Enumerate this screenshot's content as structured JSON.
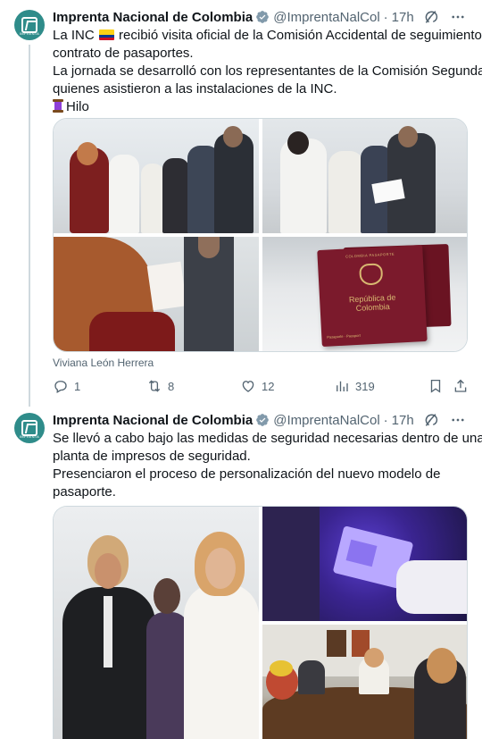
{
  "tweets": [
    {
      "author": "Imprenta Nacional de Colombia",
      "handle": "@ImprentaNalCol",
      "dot": "·",
      "time": "17h",
      "avatar_caption": "IMPRENTA",
      "text_lines": [
        {
          "before_flag": "La INC ",
          "after_flag": " recibió visita oficial de la Comisión Accidental de seguimiento al"
        },
        "contrato de pasaportes.",
        "La jornada se desarrolló con los representantes de la Comisión Segunda,",
        "quienes asistieron a las instalaciones de la INC."
      ],
      "thread_label": "Hilo",
      "media_credit": "Viviana León Herrera",
      "media_alts": [
        "Visitors touring the passport production facility",
        "Officials examining passports",
        "Woman inspecting a passport document",
        "Passport of República de Colombia"
      ],
      "passport": {
        "title": "República de Colombia",
        "header": "COLOMBIA  PASAPORTE",
        "footer": "Pasaporte · Passport"
      },
      "counts": {
        "replies": "1",
        "reposts": "8",
        "likes": "12",
        "views": "319"
      }
    },
    {
      "author": "Imprenta Nacional de Colombia",
      "handle": "@ImprentaNalCol",
      "dot": "·",
      "time": "17h",
      "avatar_caption": "IMPRENTA",
      "text_lines": [
        "Se llevó a cabo bajo las medidas de seguridad necesarias dentro de una",
        "planta de impresos de seguridad.",
        "Presenciaron el proceso de personalización del nuevo modelo de",
        "pasaporte."
      ],
      "media_alts": [
        "Officials walking through the printing plant",
        "Passport page under ultraviolet light",
        "Meeting around a conference table"
      ]
    }
  ],
  "colors": {
    "accent": "#1d9bf0",
    "muted": "#536471",
    "border": "#cfd9de",
    "passport_red": "#7b1a2c",
    "uv_purple": "#4b2aa8"
  },
  "icons": [
    "verified-badge-icon",
    "grok-icon",
    "more-icon",
    "reply-icon",
    "repost-icon",
    "like-icon",
    "views-icon",
    "bookmark-icon",
    "share-icon"
  ]
}
